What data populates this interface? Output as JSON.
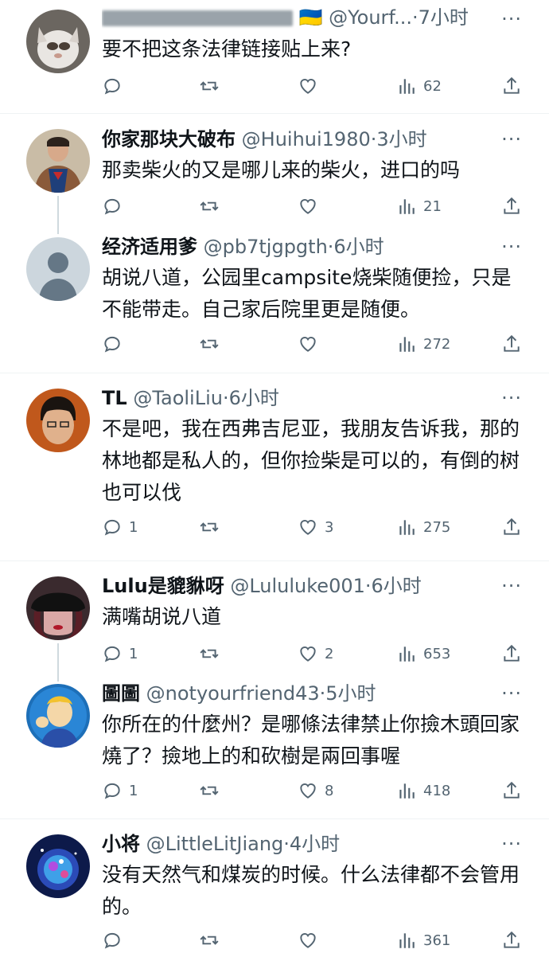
{
  "tweets": [
    {
      "name": "",
      "name_flag": "🇺🇦",
      "handle": "@Yourf...",
      "time": "·7小时",
      "text": "要不把这条法律链接贴上来?",
      "replies": "",
      "likes": "",
      "views": "62"
    },
    {
      "name": "你家那块大破布",
      "handle": "@Huihui1980",
      "time": "·3小时",
      "text": "那卖柴火的又是哪儿来的柴火，进口的吗",
      "replies": "",
      "likes": "",
      "views": "21"
    },
    {
      "name": "经济适用爹",
      "handle": "@pb7tjgpgth",
      "time": "·6小时",
      "text": "胡说八道，公园里campsite烧柴随便捡，只是不能带走。自己家后院里更是随便。",
      "replies": "",
      "likes": "",
      "views": "272"
    },
    {
      "name": "TL",
      "handle": "@TaoliLiu",
      "time": "·6小时",
      "text": "不是吧，我在西弗吉尼亚，我朋友告诉我，那的林地都是私人的，但你捡柴是可以的，有倒的树也可以伐",
      "replies": "1",
      "likes": "3",
      "views": "275"
    },
    {
      "name": "Lulu是貔貅呀",
      "handle": "@Lululuke001",
      "time": "·6小时",
      "text": "满嘴胡说八道",
      "replies": "1",
      "likes": "2",
      "views": "653"
    },
    {
      "name": "圖圖",
      "handle": "@notyourfriend43",
      "time": "·5小时",
      "text": "你所在的什麼州？是哪條法律禁止你撿木頭回家燒了？撿地上的和砍樹是兩回事喔",
      "replies": "1",
      "likes": "8",
      "views": "418"
    },
    {
      "name": "小将",
      "handle": "@LittleLitJiang",
      "time": "·4小时",
      "text": "没有天然气和煤炭的时候。什么法律都不会管用的。",
      "replies": "",
      "likes": "",
      "views": "361"
    }
  ],
  "more_glyph": "···",
  "colors": {
    "text": "#0f1419",
    "secondary": "#536471",
    "divider": "#eff3f4"
  }
}
